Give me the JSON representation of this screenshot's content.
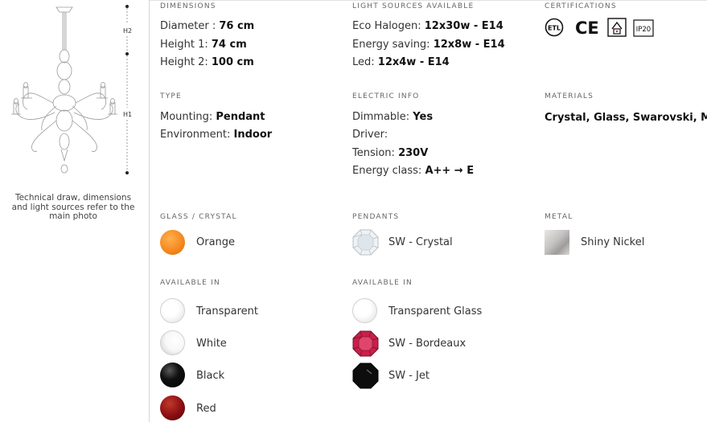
{
  "left": {
    "caption": "Technical draw, dimensions and light sources refer to the main photo",
    "dim_labels": {
      "h2": "H2",
      "h1": "H1"
    }
  },
  "dimensions": {
    "heading": "DIMENSIONS",
    "rows": [
      {
        "label": "Diameter : ",
        "value": "76 cm"
      },
      {
        "label": "Height 1: ",
        "value": "74 cm"
      },
      {
        "label": "Height 2: ",
        "value": "100 cm"
      }
    ]
  },
  "light_sources": {
    "heading": "LIGHT SOURCES AVAILABLE",
    "rows": [
      {
        "label": "Eco Halogen: ",
        "value": "12x30w - E14"
      },
      {
        "label": "Energy saving: ",
        "value": "12x8w - E14"
      },
      {
        "label": "Led: ",
        "value": "12x4w - E14"
      }
    ]
  },
  "certifications": {
    "heading": "CERTIFICATIONS",
    "icons": [
      {
        "name": "etl-icon",
        "text": "ETL"
      },
      {
        "name": "ce-icon",
        "text": "CE"
      },
      {
        "name": "class-ii-icon",
        "text": ""
      },
      {
        "name": "ip20-icon",
        "text": "IP20"
      }
    ]
  },
  "type": {
    "heading": "TYPE",
    "rows": [
      {
        "label": "Mounting: ",
        "value": "Pendant"
      },
      {
        "label": "Environment: ",
        "value": "Indoor"
      }
    ]
  },
  "electric": {
    "heading": "ELECTRIC INFO",
    "rows": [
      {
        "label": "Dimmable: ",
        "value": "Yes"
      },
      {
        "label": "Driver:",
        "value": ""
      },
      {
        "label": "Tension: ",
        "value": "230V"
      },
      {
        "label": "Energy class: ",
        "value": "A++ → E"
      }
    ]
  },
  "materials": {
    "heading": "MATERIALS",
    "value": "Crystal, Glass, Swarovski, Metal"
  },
  "glass": {
    "heading": "GLASS / CRYSTAL",
    "selected": {
      "label": "Orange",
      "color": "#f58a1f"
    },
    "available_heading": "AVAILABLE IN",
    "available": [
      {
        "label": "Transparent",
        "color": "#ffffff"
      },
      {
        "label": "White",
        "color": "#f4f4f4"
      },
      {
        "label": "Black",
        "color": "#111111"
      },
      {
        "label": "Red",
        "color": "#8a0d10"
      }
    ]
  },
  "pendants": {
    "heading": "PENDANTS",
    "selected": {
      "label": "SW - Crystal",
      "color": "#e8eef2"
    },
    "available_heading": "AVAILABLE IN",
    "available": [
      {
        "label": "Transparent Glass",
        "color": "#ffffff"
      },
      {
        "label": "SW - Bordeaux",
        "color": "#c8204a"
      },
      {
        "label": "SW - Jet",
        "color": "#0d0d0d"
      }
    ]
  },
  "metal": {
    "heading": "METAL",
    "selected": {
      "label": "Shiny Nickel",
      "color": "#c4c2c1"
    }
  }
}
